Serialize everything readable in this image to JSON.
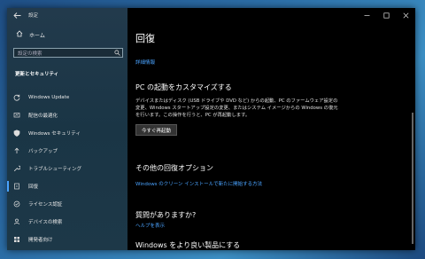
{
  "window": {
    "title": "設定"
  },
  "sidebar": {
    "home_label": "ホーム",
    "search_placeholder": "設定の検索",
    "section_heading": "更新とセキュリティ",
    "items": [
      {
        "label": "Windows Update",
        "icon": "refresh-icon"
      },
      {
        "label": "配信の最適化",
        "icon": "delivery-optimization-icon"
      },
      {
        "label": "Windows セキュリティ",
        "icon": "shield-icon"
      },
      {
        "label": "バックアップ",
        "icon": "backup-arrow-icon"
      },
      {
        "label": "トラブルシューティング",
        "icon": "wrench-icon"
      },
      {
        "label": "回復",
        "icon": "recovery-icon",
        "active": true
      },
      {
        "label": "ライセンス認証",
        "icon": "check-circle-icon"
      },
      {
        "label": "デバイスの検索",
        "icon": "person-locate-icon"
      },
      {
        "label": "開発者向け",
        "icon": "developer-tools-icon"
      }
    ]
  },
  "main": {
    "page_title": "回復",
    "details_link": "詳細情報",
    "startup_heading": "PC の起動をカスタマイズする",
    "startup_description": "デバイスまたはディスク (USB ドライブや DVD など) からの起動、PC のファームウェア設定の変更、Windows スタートアップ設定の変更、またはシステム イメージからの Windows の復元を行います。この操作を行うと、PC が再起動します。",
    "restart_button": "今すぐ再起動",
    "other_heading": "その他の回復オプション",
    "clean_install_link": "Windows のクリーン インストールで新たに開始する方法",
    "question_heading": "質問がありますか?",
    "help_link": "ヘルプを表示",
    "improve_heading": "Windows をより良い製品にする"
  },
  "colors": {
    "accent": "#4aa3ff",
    "background": "#000000",
    "sidebar": "#1f3a4a"
  }
}
